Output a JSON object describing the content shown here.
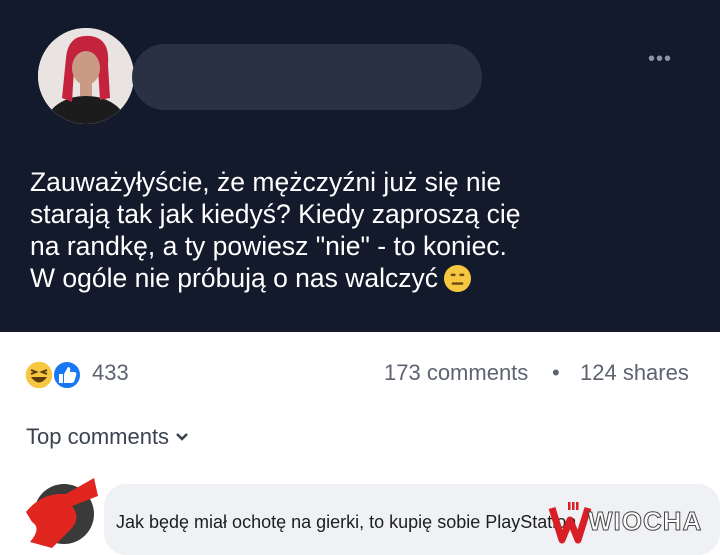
{
  "post": {
    "menu_icon": "more-dots-icon",
    "text_lines": [
      "Zauważyłyście, że mężczyźni już się nie",
      "starają tak jak kiedyś? Kiedy zaproszą cię",
      "na randkę, a ty powiesz \"nie\" - to koniec.",
      "W ogóle nie próbują o nas walczyć"
    ],
    "end_emoji": "neutral-face-emoji"
  },
  "stats": {
    "reactions_count": "433",
    "comments": "173 comments",
    "separator": "•",
    "shares": "124 shares"
  },
  "comments": {
    "header": "Top comments",
    "items": [
      {
        "text": "Jak będę miał ochotę na gierki, to kupię sobie PlayStation"
      }
    ]
  },
  "watermark": {
    "text": "WIOCHA"
  },
  "colors": {
    "post_bg": "#131a2c",
    "like_blue": "#1877f2",
    "haha_yellow": "#f7c742",
    "bubble_bg": "#f0f1f4"
  }
}
